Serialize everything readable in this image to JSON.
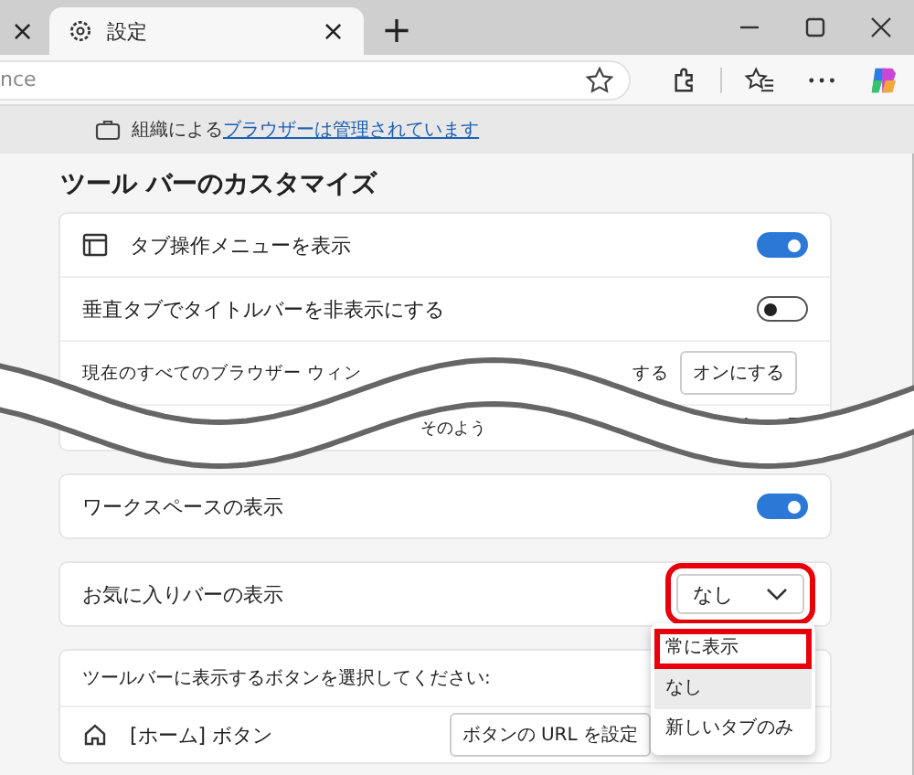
{
  "tabs": [
    {
      "close": "×",
      "selected": false
    },
    {
      "title": "設定",
      "close": "×",
      "selected": true
    }
  ],
  "new_tab": "+",
  "address_bar": {
    "value": "nce"
  },
  "managed_notice": {
    "text": "組織による",
    "link": "ブラウザーは管理されています"
  },
  "section_title": "ツール バーのカスタマイズ",
  "settings_rows": [
    {
      "kind": "icon_toggle",
      "label": "タブ操作メニューを表示",
      "on": true
    },
    {
      "kind": "toggle",
      "label": "垂直タブでタイトルバーを非表示にする",
      "on": false
    },
    {
      "kind": "buttons",
      "label_start": "現在のすべてのブラウザー ウィン",
      "label_end": "する",
      "button": "オンにする"
    },
    {
      "kind": "feedback",
      "text": "そのよう"
    }
  ],
  "workspaces": {
    "label": "ワークスペースの表示",
    "on": true
  },
  "favorites_bar": {
    "label": "お気に入りバーの表示",
    "value": "なし",
    "highlighted": true,
    "expanded": true,
    "options": [
      {
        "label": "常に表示",
        "selected": false,
        "highlighted": true
      },
      {
        "label": "なし",
        "selected": true,
        "highlighted": false
      },
      {
        "label": "新しいタブのみ",
        "selected": false,
        "highlighted": false
      }
    ]
  },
  "toolbar_buttons": {
    "prompt": "ツールバーに表示するボタンを選択してください:",
    "rows": [
      {
        "label": "[ホーム] ボタン",
        "button": "ボタンの URL を設定"
      }
    ]
  }
}
